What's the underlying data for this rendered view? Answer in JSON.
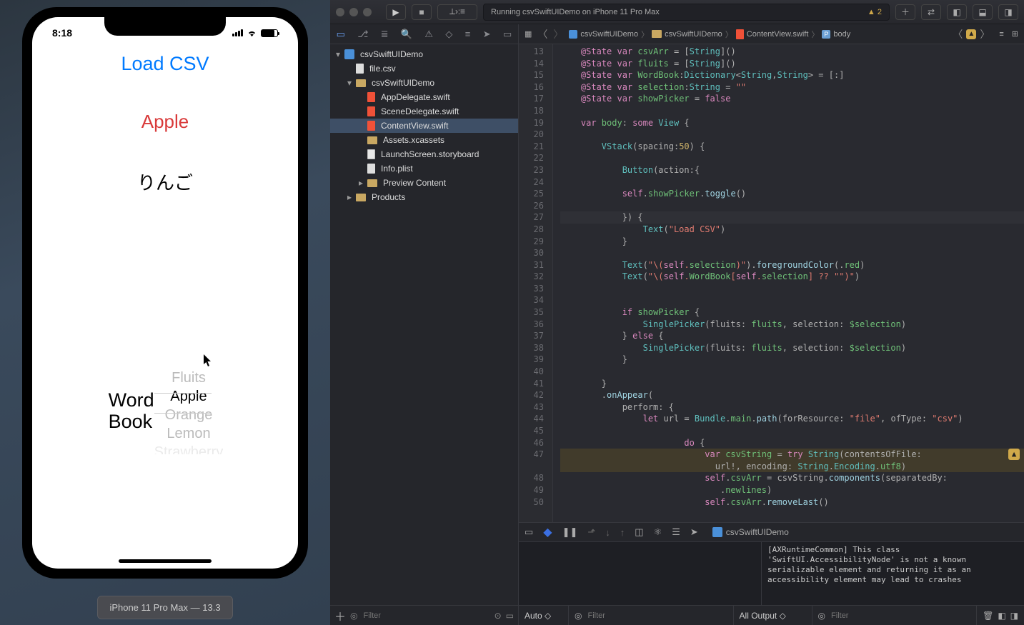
{
  "simulator": {
    "time": "8:18",
    "title": "Load CSV",
    "selected": "Apple",
    "translation": "りんご",
    "picker_label": "Word\nBook",
    "wheel": [
      "Fluits",
      "Apple",
      "Orange",
      "Lemon",
      "Strawberry"
    ],
    "device_label": "iPhone 11 Pro Max — 13.3"
  },
  "toolbar": {
    "status": "Running csvSwiftUIDemo on iPhone 11 Pro Max",
    "warn_count": "2"
  },
  "jump": {
    "proj": "csvSwiftUIDemo",
    "folder": "csvSwiftUIDemo",
    "file": "ContentView.swift",
    "symbol": "body"
  },
  "tree": [
    {
      "d": 0,
      "icon": "blue",
      "name": "csvSwiftUIDemo",
      "exp": true
    },
    {
      "d": 1,
      "icon": "file",
      "name": "file.csv"
    },
    {
      "d": 1,
      "icon": "folder",
      "name": "csvSwiftUIDemo",
      "exp": true
    },
    {
      "d": 2,
      "icon": "swift",
      "name": "AppDelegate.swift"
    },
    {
      "d": 2,
      "icon": "swift",
      "name": "SceneDelegate.swift"
    },
    {
      "d": 2,
      "icon": "swift",
      "name": "ContentView.swift",
      "sel": true
    },
    {
      "d": 2,
      "icon": "assets",
      "name": "Assets.xcassets"
    },
    {
      "d": 2,
      "icon": "sb",
      "name": "LaunchScreen.storyboard"
    },
    {
      "d": 2,
      "icon": "file",
      "name": "Info.plist"
    },
    {
      "d": 2,
      "icon": "folder",
      "name": "Preview Content",
      "exp": false,
      "closed": true
    },
    {
      "d": 1,
      "icon": "folder",
      "name": "Products",
      "exp": false,
      "closed": true
    }
  ],
  "gutter_start": 13,
  "code": [
    [
      [
        "kp",
        "    @State "
      ],
      [
        "var",
        "var "
      ],
      [
        "id",
        "csvArr"
      ],
      [
        "sl",
        " = ["
      ],
      [
        "ty",
        "String"
      ],
      [
        "sl",
        "]()"
      ]
    ],
    [
      [
        "kp",
        "    @State "
      ],
      [
        "var",
        "var "
      ],
      [
        "id",
        "fluits"
      ],
      [
        "sl",
        " = ["
      ],
      [
        "ty",
        "String"
      ],
      [
        "sl",
        "]()"
      ]
    ],
    [
      [
        "kp",
        "    @State "
      ],
      [
        "var",
        "var "
      ],
      [
        "id",
        "WordBook"
      ],
      [
        "sl",
        ":"
      ],
      [
        "ty",
        "Dictionary"
      ],
      [
        "sl",
        "<"
      ],
      [
        "ty",
        "String"
      ],
      [
        "sl",
        ","
      ],
      [
        "ty",
        "String"
      ],
      [
        "sl",
        "> = [:]"
      ]
    ],
    [
      [
        "kp",
        "    @State "
      ],
      [
        "var",
        "var "
      ],
      [
        "id",
        "selection"
      ],
      [
        "sl",
        ":"
      ],
      [
        "ty",
        "String"
      ],
      [
        "sl",
        " = "
      ],
      [
        "st",
        "\"\""
      ]
    ],
    [
      [
        "kp",
        "    @State "
      ],
      [
        "var",
        "var "
      ],
      [
        "id",
        "showPicker"
      ],
      [
        "sl",
        " = "
      ],
      [
        "bool",
        "false"
      ]
    ],
    [
      [
        "sl",
        ""
      ]
    ],
    [
      [
        "kp",
        "    var "
      ],
      [
        "id",
        "body"
      ],
      [
        "sl",
        ": "
      ],
      [
        "kp",
        "some "
      ],
      [
        "ty",
        "View"
      ],
      [
        "sl",
        " {"
      ]
    ],
    [
      [
        "sl",
        ""
      ]
    ],
    [
      [
        "sl",
        "        "
      ],
      [
        "ty",
        "VStack"
      ],
      [
        "sl",
        "(spacing:"
      ],
      [
        "nu",
        "50"
      ],
      [
        "sl",
        ") {"
      ]
    ],
    [
      [
        "sl",
        ""
      ]
    ],
    [
      [
        "sl",
        "            "
      ],
      [
        "ty",
        "Button"
      ],
      [
        "sl",
        "(action:{"
      ]
    ],
    [
      [
        "sl",
        ""
      ]
    ],
    [
      [
        "sl",
        "            "
      ],
      [
        "kp",
        "self"
      ],
      [
        "sl",
        "."
      ],
      [
        "id",
        "showPicker"
      ],
      [
        "sl",
        "."
      ],
      [
        "fn",
        "toggle"
      ],
      [
        "sl",
        "()"
      ]
    ],
    [
      [
        "sl",
        ""
      ]
    ],
    [
      [
        "sl",
        "            }) {"
      ]
    ],
    [
      [
        "sl",
        "                "
      ],
      [
        "ty",
        "Text"
      ],
      [
        "sl",
        "("
      ],
      [
        "st",
        "\"Load CSV\""
      ],
      [
        "sl",
        ")"
      ]
    ],
    [
      [
        "sl",
        "            }"
      ]
    ],
    [
      [
        "sl",
        ""
      ]
    ],
    [
      [
        "sl",
        "            "
      ],
      [
        "ty",
        "Text"
      ],
      [
        "sl",
        "("
      ],
      [
        "st",
        "\"\\("
      ],
      [
        "kp",
        "self"
      ],
      [
        "st",
        "."
      ],
      [
        "id",
        "selection"
      ],
      [
        "st",
        ")\""
      ],
      [
        "sl",
        ")."
      ],
      [
        "fn",
        "foregroundColor"
      ],
      [
        "sl",
        "(."
      ],
      [
        "id",
        "red"
      ],
      [
        "sl",
        ")"
      ]
    ],
    [
      [
        "sl",
        "            "
      ],
      [
        "ty",
        "Text"
      ],
      [
        "sl",
        "("
      ],
      [
        "st",
        "\"\\("
      ],
      [
        "kp",
        "self"
      ],
      [
        "st",
        "."
      ],
      [
        "id",
        "WordBook"
      ],
      [
        "st",
        "["
      ],
      [
        "kp",
        "self"
      ],
      [
        "st",
        "."
      ],
      [
        "id",
        "selection"
      ],
      [
        "st",
        "] ?? "
      ],
      [
        "st",
        "\"\""
      ],
      [
        "st",
        ")\""
      ],
      [
        "sl",
        ")"
      ]
    ],
    [
      [
        "sl",
        ""
      ]
    ],
    [
      [
        "sl",
        ""
      ]
    ],
    [
      [
        "sl",
        "            "
      ],
      [
        "kp",
        "if "
      ],
      [
        "id",
        "showPicker"
      ],
      [
        "sl",
        " {"
      ]
    ],
    [
      [
        "sl",
        "                "
      ],
      [
        "ty",
        "SinglePicker"
      ],
      [
        "sl",
        "(fluits: "
      ],
      [
        "id",
        "fluits"
      ],
      [
        "sl",
        ", selection: "
      ],
      [
        "id",
        "$selection"
      ],
      [
        "sl",
        ")"
      ]
    ],
    [
      [
        "sl",
        "            } "
      ],
      [
        "kp",
        "else"
      ],
      [
        "sl",
        " {"
      ]
    ],
    [
      [
        "sl",
        "                "
      ],
      [
        "ty",
        "SinglePicker"
      ],
      [
        "sl",
        "(fluits: "
      ],
      [
        "id",
        "fluits"
      ],
      [
        "sl",
        ", selection: "
      ],
      [
        "id",
        "$selection"
      ],
      [
        "sl",
        ")"
      ]
    ],
    [
      [
        "sl",
        "            }"
      ]
    ],
    [
      [
        "sl",
        ""
      ]
    ],
    [
      [
        "sl",
        "        }"
      ]
    ],
    [
      [
        "sl",
        "        ."
      ],
      [
        "fn",
        "onAppear"
      ],
      [
        "sl",
        "("
      ]
    ],
    [
      [
        "sl",
        "            perform: {"
      ]
    ],
    [
      [
        "sl",
        "                "
      ],
      [
        "kp",
        "let "
      ],
      [
        "sl",
        "url = "
      ],
      [
        "ty",
        "Bundle"
      ],
      [
        "sl",
        "."
      ],
      [
        "id",
        "main"
      ],
      [
        "sl",
        "."
      ],
      [
        "fn",
        "path"
      ],
      [
        "sl",
        "(forResource: "
      ],
      [
        "st",
        "\"file\""
      ],
      [
        "sl",
        ", ofType: "
      ],
      [
        "st",
        "\"csv\""
      ],
      [
        "sl",
        ")"
      ]
    ],
    [
      [
        "sl",
        ""
      ]
    ],
    [
      [
        "sl",
        "                        "
      ],
      [
        "kp",
        "do"
      ],
      [
        "sl",
        " {"
      ]
    ],
    [
      [
        "sl",
        "                            "
      ],
      [
        "kp",
        "var "
      ],
      [
        "id",
        "csvString"
      ],
      [
        "sl",
        " = "
      ],
      [
        "kp",
        "try "
      ],
      [
        "ty",
        "String"
      ],
      [
        "sl",
        "(contentsOfFile:"
      ]
    ],
    [
      [
        "sl",
        "                              url!, encoding: "
      ],
      [
        "ty",
        "String"
      ],
      [
        "sl",
        "."
      ],
      [
        "ty",
        "Encoding"
      ],
      [
        "sl",
        "."
      ],
      [
        "id",
        "utf8"
      ],
      [
        "sl",
        ")"
      ]
    ],
    [
      [
        "sl",
        "                            "
      ],
      [
        "kp",
        "self"
      ],
      [
        "sl",
        "."
      ],
      [
        "id",
        "csvArr"
      ],
      [
        "sl",
        " = csvString."
      ],
      [
        "fn",
        "components"
      ],
      [
        "sl",
        "(separatedBy:"
      ]
    ],
    [
      [
        "sl",
        "                               ."
      ],
      [
        "id",
        "newlines"
      ],
      [
        "sl",
        ")"
      ]
    ],
    [
      [
        "sl",
        "                            "
      ],
      [
        "kp",
        "self"
      ],
      [
        "sl",
        "."
      ],
      [
        "id",
        "csvArr"
      ],
      [
        "sl",
        "."
      ],
      [
        "fn",
        "removeLast"
      ],
      [
        "sl",
        "()"
      ]
    ]
  ],
  "warn_line_index": 34,
  "highlighted_line_index": 14,
  "debug": {
    "target": "csvSwiftUIDemo",
    "console": "[AXRuntimeCommon] This class 'SwiftUI.AccessibilityNode' is not a known serializable element and returning it as an accessibility element may lead to crashes",
    "auto": "Auto ◇",
    "all_output": "All Output ◇"
  },
  "filter_placeholder": "Filter"
}
